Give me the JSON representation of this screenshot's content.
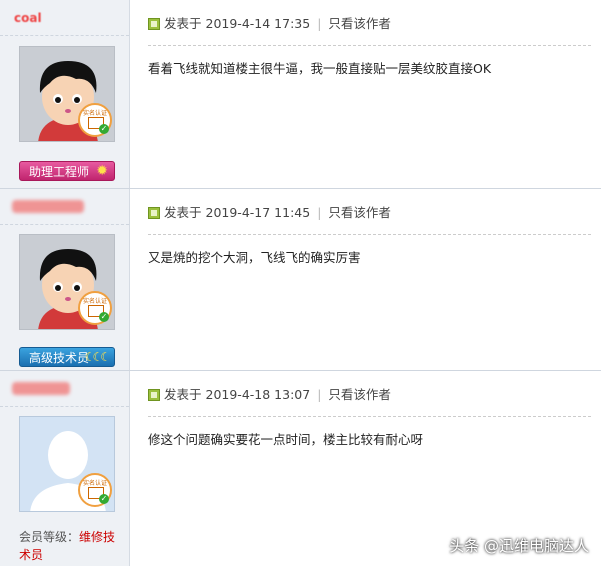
{
  "posts": [
    {
      "author": "coal",
      "badge_label": "助理工程师",
      "badge_color": "#d33a85",
      "posted_prefix": "发表于",
      "timestamp": "2019-4-14 17:35",
      "only_author": "只看该作者",
      "content": "看着飞线就知道楼主很牛逼，我一般直接贴一层美纹胶直接OK"
    },
    {
      "author": "",
      "badge_label": "高级技术员",
      "badge_color": "#2b8bd0",
      "posted_prefix": "发表于",
      "timestamp": "2019-4-17 11:45",
      "only_author": "只看该作者",
      "content": "又是焼的挖个大洞，飞线飞的确实厉害"
    },
    {
      "author": "",
      "level_label": "会员等级：",
      "level_value": "维修技术员",
      "posted_prefix": "发表于",
      "timestamp": "2019-4-18 13:07",
      "only_author": "只看该作者",
      "content": "修这个问题确实要花一点时间，楼主比较有耐心呀"
    }
  ],
  "verified_label": "实名认证",
  "watermark": "头条 @迅维电脑达人"
}
